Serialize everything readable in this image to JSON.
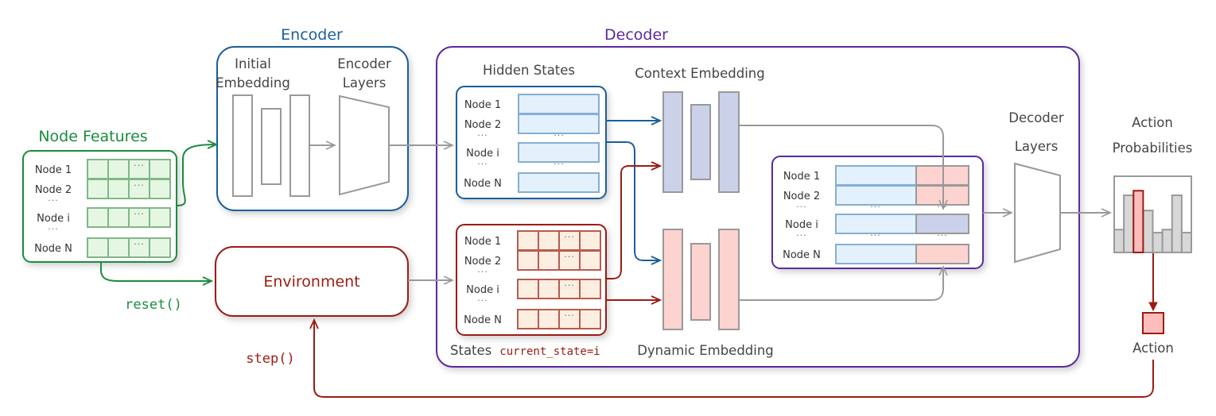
{
  "colors": {
    "green": "#1a8c3e",
    "green_fill": "#e5f7e2",
    "green_cell_stroke": "#7fb887",
    "blue": "#1b5f99",
    "blue_fill": "#e2f1fc",
    "blue_cell_stroke": "#86aed3",
    "red": "#9b1c12",
    "red_fill": "#fdeee2",
    "red_cell_stroke": "#b85b4f",
    "purple": "#5b2a9e",
    "gray": "#999999",
    "lavender_fill": "#ccd1ea",
    "pink_fill": "#fdd3cf",
    "hist_fill": "#d7d7d7",
    "hist_highlight": "#fdbdbd",
    "text": "#333333"
  },
  "node_features": {
    "title": "Node Features",
    "rows": [
      "Node 1",
      "Node 2",
      "···",
      "Node i",
      "···",
      "Node N"
    ],
    "cell_dots": "···"
  },
  "encoder": {
    "title": "Encoder",
    "initial_embedding_line1": "Initial",
    "initial_embedding_line2": "Embedding",
    "encoder_layers_line1": "Encoder",
    "encoder_layers_line2": "Layers"
  },
  "environment": {
    "label": "Environment",
    "reset_label": "reset()",
    "step_label": "step()"
  },
  "decoder": {
    "title": "Decoder",
    "hidden_states": {
      "title": "Hidden States",
      "rows": [
        "Node 1",
        "Node 2",
        "···",
        "Node i",
        "···",
        "Node N"
      ],
      "dots": "···"
    },
    "states": {
      "title": "States",
      "code": "current_state=i",
      "rows": [
        "Node 1",
        "Node 2",
        "···",
        "Node i",
        "···",
        "Node N"
      ],
      "cell_dots": "···"
    },
    "context_embedding": "Context Embedding",
    "dynamic_embedding": "Dynamic Embedding",
    "combined": {
      "rows": [
        "Node 1",
        "Node 2",
        "···",
        "Node i",
        "···",
        "Node N"
      ],
      "dots": "···"
    },
    "decoder_layers_line1": "Decoder",
    "decoder_layers_line2": "Layers"
  },
  "action_probabilities": {
    "title_line1": "Action",
    "title_line2": "Probabilities",
    "bars": [
      0.3,
      0.75,
      0.81,
      0.55,
      0.26,
      0.3,
      0.75,
      0.26
    ],
    "selected_index": 2
  },
  "action": {
    "label": "Action"
  }
}
